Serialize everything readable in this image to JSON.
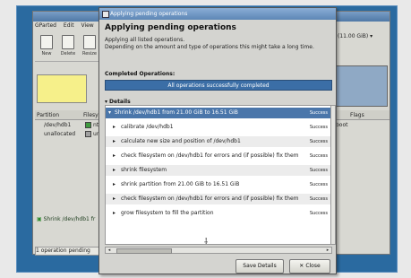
{
  "bg_window": {
    "menu": [
      "GParted",
      "Edit",
      "View"
    ],
    "toolbar": [
      {
        "icon": "new-icon",
        "label": "New"
      },
      {
        "icon": "delete-icon",
        "label": "Delete"
      },
      {
        "icon": "resize-icon",
        "label": "Resize"
      }
    ],
    "disk_selector": "(11.00 GiB)",
    "table_headers": [
      "Partition",
      "Filesystem",
      "Flags"
    ],
    "rows": [
      {
        "partition": "/dev/hdb1",
        "fs": "ntfs",
        "flags": "boot"
      },
      {
        "partition": "unallocated",
        "fs": "unallocated",
        "flags": ""
      }
    ],
    "pending_operation": "Shrink /dev/hdb1 fr",
    "status": "1 operation pending"
  },
  "dialog": {
    "title": "Applying pending operations",
    "heading": "Applying pending operations",
    "desc_line1": "Applying all listed operations.",
    "desc_line2": "Depending on the amount and type of operations this might take a long time.",
    "completed_label": "Completed Operations:",
    "progress_text": "All operations successfully completed",
    "details_label": "Details",
    "top_operation": "Shrink /dev/hdb1 from 21.00 GiB to 16.51 GiB",
    "operations": [
      "calibrate /dev/hdb1",
      "calculate new size and position of /dev/hdb1",
      "check filesystem on /dev/hdb1 for errors and (if possible) fix them",
      "shrink filesystem",
      "shrink partition from 21.00 GiB to 16.51 GiB",
      "check filesystem on /dev/hdb1 for errors and (if possible) fix them",
      "grow filesystem to fill the partition"
    ],
    "state": "Success",
    "buttons": {
      "save": "Save Details",
      "close": "Close"
    }
  }
}
